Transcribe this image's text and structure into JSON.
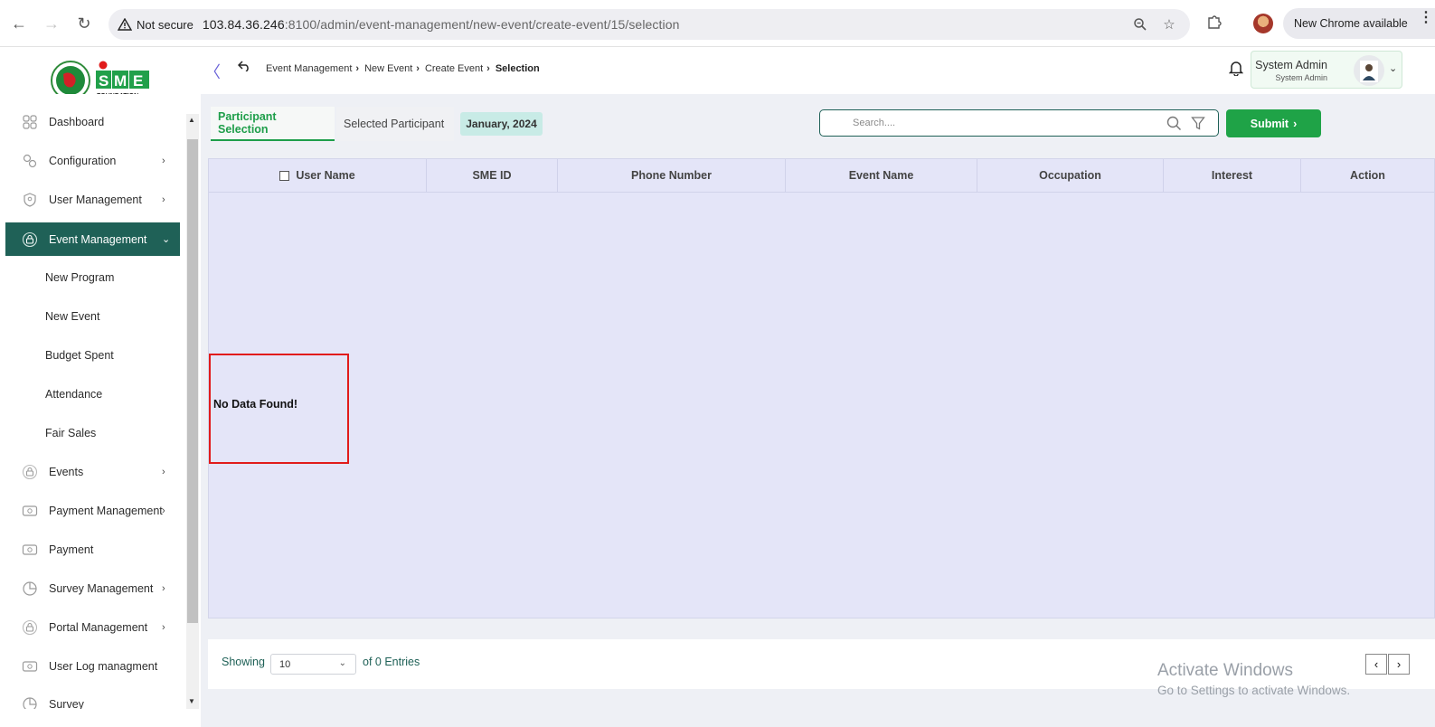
{
  "browser": {
    "security_label": "Not secure",
    "url_host": "103.84.36.246",
    "url_rest": ":8100/admin/event-management/new-event/create-event/15/selection",
    "new_chrome_label": "New Chrome available"
  },
  "header": {
    "breadcrumb": [
      "Event Management",
      "New Event",
      "Create Event",
      "Selection"
    ],
    "user_name": "System Admin",
    "user_role": "System Admin"
  },
  "logo": {
    "text": "SME",
    "subtext": "FOUNDATION"
  },
  "sidebar": {
    "items": [
      {
        "label": "Dashboard",
        "icon": "grid-icon",
        "has_arrow": false
      },
      {
        "label": "Configuration",
        "icon": "config-icon",
        "has_arrow": true
      },
      {
        "label": "User Management",
        "icon": "shield-user-icon",
        "has_arrow": true
      },
      {
        "label": "Event Management",
        "icon": "lock-icon",
        "has_arrow": true,
        "active": true
      },
      {
        "label": "Events",
        "icon": "lock-icon",
        "has_arrow": true
      },
      {
        "label": "Payment Management",
        "icon": "cash-icon",
        "has_arrow": true
      },
      {
        "label": "Payment",
        "icon": "cash-icon",
        "has_arrow": false
      },
      {
        "label": "Survey Management",
        "icon": "pie-icon",
        "has_arrow": true
      },
      {
        "label": "Portal Management",
        "icon": "lock-icon",
        "has_arrow": true
      },
      {
        "label": "User Log managment",
        "icon": "cash-icon",
        "has_arrow": false
      },
      {
        "label": "Survey",
        "icon": "pie-icon",
        "has_arrow": false
      }
    ],
    "sub_items": [
      "New Program",
      "New Event",
      "Budget Spent",
      "Attendance",
      "Fair Sales"
    ]
  },
  "main": {
    "tabs": [
      "Participant Selection",
      "Selected Participant"
    ],
    "date_badge": "January, 2024",
    "search_placeholder": "Search....",
    "submit_label": "Submit",
    "columns": [
      "User Name",
      "SME ID",
      "Phone Number",
      "Event Name",
      "Occupation",
      "Interest",
      "Action"
    ],
    "empty_message": "No Data Found!",
    "footer": {
      "showing_label": "Showing",
      "page_size": "10",
      "entries_label": "of 0 Entries"
    }
  },
  "watermark": {
    "title": "Activate Windows",
    "subtitle": "Go to Settings to activate Windows."
  },
  "colors": {
    "primary_dark": "#1f6157",
    "accent_green": "#1fa347",
    "table_bg": "#e4e5f8",
    "highlight_red": "#e11b1b"
  }
}
